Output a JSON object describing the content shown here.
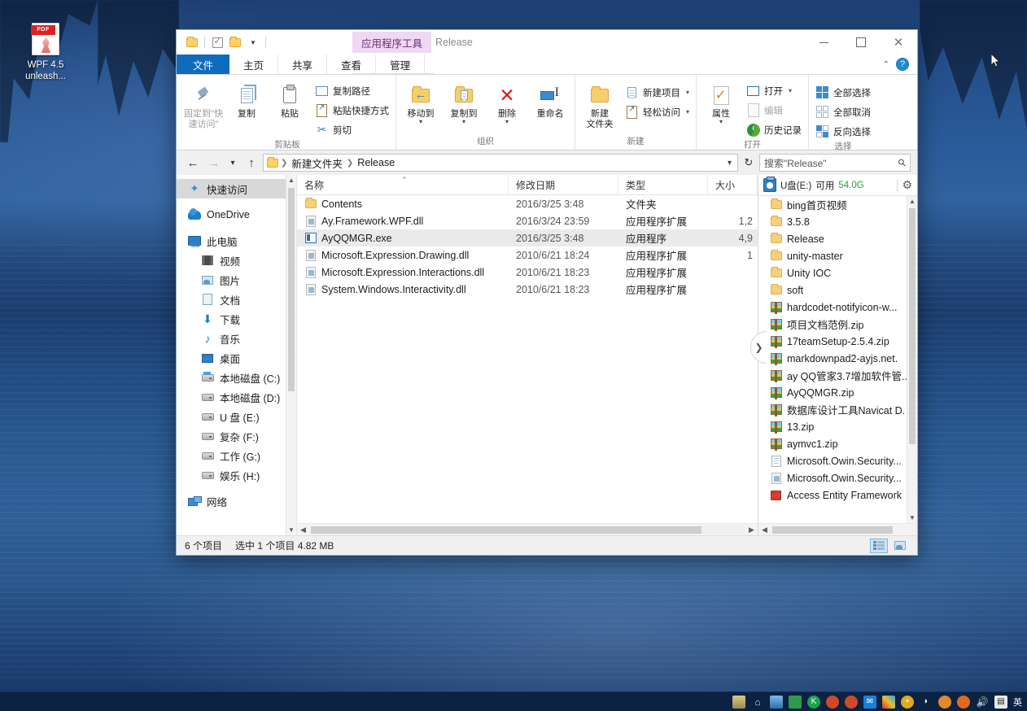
{
  "desktop": {
    "icon": {
      "name": "WPF 4.5\nunleash...",
      "line1": "WPF 4.5",
      "line2": "unleash...",
      "badge": "PDF"
    }
  },
  "window": {
    "contextual_tab": "应用程序工具",
    "title": "Release",
    "quick_access": [
      "folder-icon",
      "checkbox-icon",
      "folder-icon",
      "dropdown-caret"
    ],
    "controls": {
      "minimize": "—",
      "maximize": "□",
      "close": "✕",
      "collapse_ribbon": "⌃",
      "help": "?"
    },
    "tabs": [
      {
        "label": "文件",
        "active": true
      },
      {
        "label": "主页",
        "active": false
      },
      {
        "label": "共享",
        "active": false
      },
      {
        "label": "查看",
        "active": false
      },
      {
        "label": "管理",
        "active": false
      }
    ]
  },
  "ribbon": {
    "groups": [
      {
        "title": "剪贴板",
        "big": [
          {
            "label": "固定到\"快速访问\"",
            "line1": "固定到\"快",
            "line2": "速访问\"",
            "icon": "pin-icon",
            "disabled": true
          },
          {
            "label": "复制",
            "icon": "copy-icon",
            "disabled": false
          },
          {
            "label": "粘贴",
            "icon": "paste-icon",
            "disabled": false
          }
        ],
        "small": [
          {
            "label": "复制路径",
            "icon": "copy-path-icon"
          },
          {
            "label": "粘贴快捷方式",
            "icon": "paste-shortcut-icon"
          },
          {
            "label": "剪切",
            "icon": "scissors-icon"
          }
        ]
      },
      {
        "title": "组织",
        "big": [
          {
            "label": "移动到",
            "icon": "move-to-icon",
            "caret": "▾"
          },
          {
            "label": "复制到",
            "icon": "copy-to-icon",
            "caret": "▾"
          },
          {
            "label": "删除",
            "icon": "delete-icon",
            "caret": "▾"
          },
          {
            "label": "重命名",
            "icon": "rename-icon"
          }
        ]
      },
      {
        "title": "新建",
        "big": [
          {
            "label": "新建文件夹",
            "line1": "新建",
            "line2": "文件夹",
            "icon": "new-folder-icon"
          }
        ],
        "small": [
          {
            "label": "新建项目",
            "icon": "new-item-icon",
            "caret": "▾"
          },
          {
            "label": "轻松访问",
            "icon": "easy-access-icon",
            "caret": "▾"
          }
        ]
      },
      {
        "title": "打开",
        "big": [
          {
            "label": "属性",
            "icon": "properties-icon",
            "caret": "▾"
          }
        ],
        "small": [
          {
            "label": "打开",
            "icon": "open-icon",
            "caret": "▾"
          },
          {
            "label": "编辑",
            "icon": "edit-icon",
            "disabled": true
          },
          {
            "label": "历史记录",
            "icon": "history-icon"
          }
        ]
      },
      {
        "title": "选择",
        "small": [
          {
            "label": "全部选择",
            "icon": "select-all-icon"
          },
          {
            "label": "全部取消",
            "icon": "select-none-icon"
          },
          {
            "label": "反向选择",
            "icon": "invert-selection-icon"
          }
        ]
      }
    ]
  },
  "addressbar": {
    "back": "←",
    "forward": "→",
    "recent": "▾",
    "up": "↑",
    "crumbs": [
      "新建文件夹",
      "Release"
    ],
    "dropdown_caret": "▾",
    "refresh": "↻"
  },
  "search": {
    "placeholder": "搜索\"Release\"",
    "value": "搜索\"Release\"",
    "icon": "search-icon"
  },
  "navpane": {
    "items": [
      {
        "label": "快速访问",
        "icon": "star-icon",
        "indent": false,
        "selected": true
      },
      {
        "label": "OneDrive",
        "icon": "cloud-icon",
        "indent": false,
        "selected": false
      },
      {
        "label": "此电脑",
        "icon": "this-pc-icon",
        "indent": false,
        "selected": false
      },
      {
        "label": "视频",
        "icon": "video-icon",
        "indent": true,
        "selected": false
      },
      {
        "label": "图片",
        "icon": "pictures-icon",
        "indent": true,
        "selected": false
      },
      {
        "label": "文档",
        "icon": "documents-icon",
        "indent": true,
        "selected": false
      },
      {
        "label": "下载",
        "icon": "downloads-icon",
        "indent": true,
        "selected": false
      },
      {
        "label": "音乐",
        "icon": "music-icon",
        "indent": true,
        "selected": false
      },
      {
        "label": "桌面",
        "icon": "desktop-icon",
        "indent": true,
        "selected": false
      },
      {
        "label": "本地磁盘 (C:)",
        "icon": "system-drive-icon",
        "indent": true,
        "selected": false
      },
      {
        "label": "本地磁盘 (D:)",
        "icon": "drive-icon",
        "indent": true,
        "selected": false
      },
      {
        "label": "U 盘 (E:)",
        "icon": "drive-icon",
        "indent": true,
        "selected": false
      },
      {
        "label": "复杂 (F:)",
        "icon": "drive-icon",
        "indent": true,
        "selected": false
      },
      {
        "label": "工作 (G:)",
        "icon": "drive-icon",
        "indent": true,
        "selected": false
      },
      {
        "label": "娱乐 (H:)",
        "icon": "drive-icon",
        "indent": true,
        "selected": false
      },
      {
        "label": "网络",
        "icon": "network-icon",
        "indent": false,
        "selected": false
      }
    ]
  },
  "filelist": {
    "columns": [
      "名称",
      "修改日期",
      "类型",
      "大小"
    ],
    "sort_indicator": "⌃",
    "rows": [
      {
        "name": "Contents",
        "date": "2016/3/25 3:48",
        "type": "文件夹",
        "size": "",
        "icon": "folder-icon",
        "selected": false
      },
      {
        "name": "Ay.Framework.WPF.dll",
        "date": "2016/3/24 23:59",
        "type": "应用程序扩展",
        "size": "1,2",
        "icon": "dll-icon",
        "selected": false
      },
      {
        "name": "AyQQMGR.exe",
        "date": "2016/3/25 3:48",
        "type": "应用程序",
        "size": "4,9",
        "icon": "exe-icon",
        "selected": true
      },
      {
        "name": "Microsoft.Expression.Drawing.dll",
        "date": "2010/6/21 18:24",
        "type": "应用程序扩展",
        "size": "1",
        "icon": "dll-icon",
        "selected": false
      },
      {
        "name": "Microsoft.Expression.Interactions.dll",
        "date": "2010/6/21 18:23",
        "type": "应用程序扩展",
        "size": "",
        "icon": "dll-icon",
        "selected": false
      },
      {
        "name": "System.Windows.Interactivity.dll",
        "date": "2010/6/21 18:23",
        "type": "应用程序扩展",
        "size": "",
        "icon": "dll-icon",
        "selected": false
      }
    ]
  },
  "usbpane": {
    "header": {
      "drive": "U盘(E:)",
      "free_label": "可用",
      "free_value": "54.0G",
      "gear": "⚙",
      "icon": "usb-drive-icon"
    },
    "items": [
      {
        "label": "bing首页视频",
        "icon": "folder-icon"
      },
      {
        "label": "3.5.8",
        "icon": "folder-icon"
      },
      {
        "label": "Release",
        "icon": "folder-icon"
      },
      {
        "label": "unity-master",
        "icon": "folder-icon"
      },
      {
        "label": "Unity IOC",
        "icon": "folder-icon"
      },
      {
        "label": "soft",
        "icon": "folder-icon"
      },
      {
        "label": "hardcodet-notifyicon-w...",
        "icon": "zip-icon"
      },
      {
        "label": "项目文档范例.zip",
        "icon": "zip-icon"
      },
      {
        "label": "17teamSetup-2.5.4.zip",
        "icon": "zip-icon"
      },
      {
        "label": "markdownpad2-ayjs.net.",
        "icon": "zip-icon"
      },
      {
        "label": "ay QQ管家3.7增加软件管..",
        "icon": "zip-icon"
      },
      {
        "label": "AyQQMGR.zip",
        "icon": "zip-icon"
      },
      {
        "label": "数据库设计工具Navicat D.",
        "icon": "zip-icon"
      },
      {
        "label": "13.zip",
        "icon": "zip-icon"
      },
      {
        "label": "aymvc1.zip",
        "icon": "zip-icon"
      },
      {
        "label": "Microsoft.Owin.Security...",
        "icon": "xml-icon"
      },
      {
        "label": "Microsoft.Owin.Security...",
        "icon": "dll-icon"
      },
      {
        "label": "Access Entity Framework",
        "icon": "red-icon"
      }
    ],
    "splitter_arrow": "❯"
  },
  "statusbar": {
    "count": "6 个项目",
    "selection": "选中 1 个项目  4.82 MB",
    "views": [
      {
        "name": "details-view",
        "active": true
      },
      {
        "name": "large-icons-view",
        "active": false
      }
    ]
  },
  "taskbar": {
    "tray_text": "英",
    "icons": [
      "app-icon-1",
      "onedrive-icon",
      "app-icon-2",
      "app-icon-3",
      "kugou-icon",
      "app-icon-4",
      "app-icon-5",
      "mail-icon",
      "colors-icon",
      "plus-icon",
      "network-icon",
      "browser-icon",
      "firefox-icon",
      "volume-icon",
      "notifications-icon"
    ]
  },
  "colors": {
    "accent": "#0f6cbd",
    "contextual_tab": "#efd8f3",
    "contextual_tab_text": "#6a2d7a",
    "selection": "#eaeaea",
    "free_space": "#2c9a3c",
    "taskbar": "#0b2242"
  }
}
